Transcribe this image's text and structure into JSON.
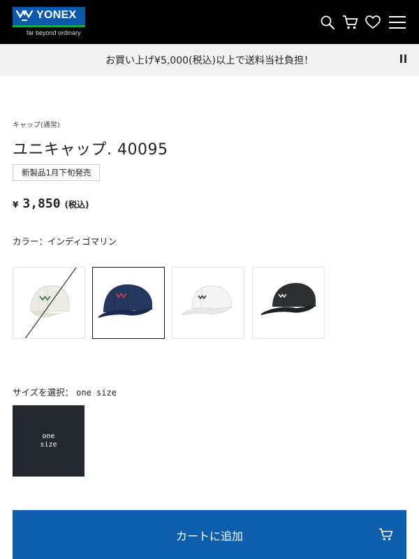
{
  "header": {
    "logo_text": "YONEX",
    "tagline": "far beyond ordinary",
    "icons": [
      "search-icon",
      "cart-icon",
      "heart-icon",
      "menu-icon"
    ]
  },
  "banner": {
    "text": "お買い上げ¥5,000(税込)以上で送料当社負担！",
    "control_icon": "pause-icon"
  },
  "product": {
    "category": "キャップ(通常)",
    "title": "ユニキャップ. 40095",
    "badge": "新製品1月下旬発売",
    "price": {
      "currency": "¥",
      "amount": "3,850",
      "tax_note": "(税込)"
    },
    "color_label": "カラー：インディゴマリン",
    "swatches": [
      {
        "color": "#ecebe4",
        "status": "sold-out"
      },
      {
        "color": "#24375e",
        "status": "selected"
      },
      {
        "color": "#f4f4f4",
        "status": "available"
      },
      {
        "color": "#2e2f31",
        "status": "available"
      }
    ],
    "size_label": "サイズを選択：",
    "size_value": "one size",
    "size_option": "one size"
  },
  "cart": {
    "label": "カートに追加",
    "icon": "cart-icon"
  },
  "colors": {
    "header_bg": "#000000",
    "banner_bg": "#f2f2f2",
    "brand_blue": "#0a59ad",
    "cart_button": "#0d5eac",
    "size_box": "#22282d"
  }
}
